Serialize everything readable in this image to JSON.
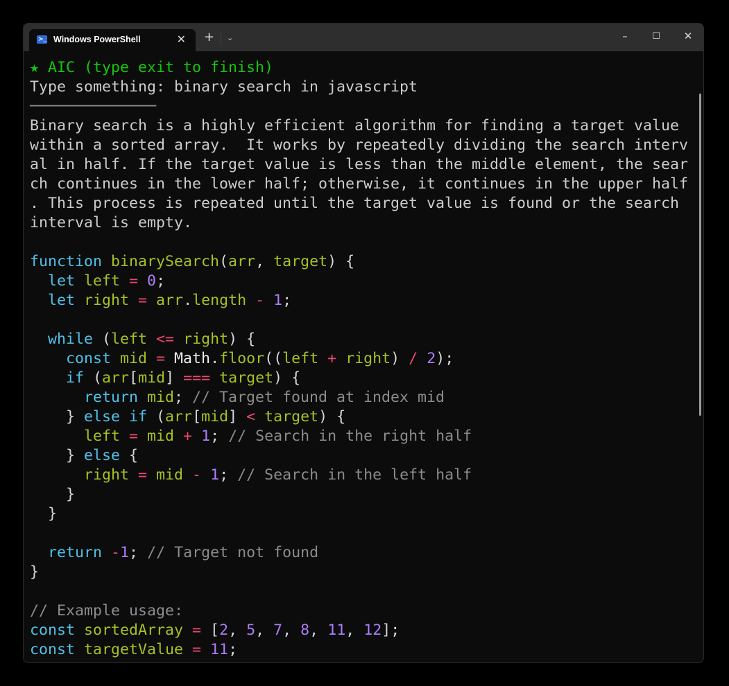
{
  "window": {
    "tab_title": "Windows PowerShell",
    "tab_icon": "powershell-icon",
    "close_tab": "✕",
    "new_tab": "+",
    "dropdown": "⌄",
    "minimize": "–",
    "maximize": "☐",
    "close": "✕"
  },
  "colors": {
    "background": "#0c0c0c",
    "titlebar": "#2e2e2e",
    "keyword": "#4fc1e9",
    "identifier": "#a8c023",
    "operator": "#f0476e",
    "number": "#ab7df8",
    "comment": "#8c8c8c",
    "prompt": "#16c60c"
  },
  "lines": [
    [
      [
        "g",
        "★ AIC (type exit to finish)"
      ]
    ],
    [
      [
        "t",
        "Type something: binary search in javascript"
      ]
    ],
    [
      [
        "c",
        "──────────────"
      ]
    ],
    [
      [
        "t",
        "Binary search is a highly efficient algorithm for finding a target value"
      ]
    ],
    [
      [
        "t",
        "within a sorted array.  It works by repeatedly dividing the search interv"
      ]
    ],
    [
      [
        "t",
        "al in half. If the target value is less than the middle element, the sear"
      ]
    ],
    [
      [
        "t",
        "ch continues in the lower half; otherwise, it continues in the upper half"
      ]
    ],
    [
      [
        "t",
        ". This process is repeated until the target value is found or the search"
      ]
    ],
    [
      [
        "t",
        "interval is empty."
      ]
    ],
    [],
    [
      [
        "k",
        "function "
      ],
      [
        "i",
        "binarySearch"
      ],
      [
        "p",
        "("
      ],
      [
        "i",
        "arr"
      ],
      [
        "p",
        ", "
      ],
      [
        "i",
        "target"
      ],
      [
        "p",
        ") {"
      ]
    ],
    [
      [
        "k",
        "  let "
      ],
      [
        "i",
        "left "
      ],
      [
        "o",
        "= "
      ],
      [
        "n",
        "0"
      ],
      [
        "p",
        ";"
      ]
    ],
    [
      [
        "k",
        "  let "
      ],
      [
        "i",
        "right "
      ],
      [
        "o",
        "= "
      ],
      [
        "i",
        "arr"
      ],
      [
        "p",
        "."
      ],
      [
        "i",
        "length "
      ],
      [
        "o",
        "- "
      ],
      [
        "n",
        "1"
      ],
      [
        "p",
        ";"
      ]
    ],
    [],
    [
      [
        "k",
        "  while "
      ],
      [
        "p",
        "("
      ],
      [
        "i",
        "left "
      ],
      [
        "o",
        "<= "
      ],
      [
        "i",
        "right"
      ],
      [
        "p",
        ") {"
      ]
    ],
    [
      [
        "k",
        "    const "
      ],
      [
        "i",
        "mid "
      ],
      [
        "o",
        "= "
      ],
      [
        "w",
        "Math"
      ],
      [
        "p",
        "."
      ],
      [
        "i",
        "floor"
      ],
      [
        "p",
        "(("
      ],
      [
        "i",
        "left "
      ],
      [
        "o",
        "+ "
      ],
      [
        "i",
        "right"
      ],
      [
        "p",
        ") "
      ],
      [
        "o",
        "/ "
      ],
      [
        "n",
        "2"
      ],
      [
        "p",
        ");"
      ]
    ],
    [
      [
        "k",
        "    if "
      ],
      [
        "p",
        "("
      ],
      [
        "i",
        "arr"
      ],
      [
        "p",
        "["
      ],
      [
        "i",
        "mid"
      ],
      [
        "p",
        "] "
      ],
      [
        "o",
        "=== "
      ],
      [
        "i",
        "target"
      ],
      [
        "p",
        ") {"
      ]
    ],
    [
      [
        "k",
        "      return "
      ],
      [
        "i",
        "mid"
      ],
      [
        "p",
        "; "
      ],
      [
        "c",
        "// Target found at index mid"
      ]
    ],
    [
      [
        "p",
        "    } "
      ],
      [
        "k",
        "else if "
      ],
      [
        "p",
        "("
      ],
      [
        "i",
        "arr"
      ],
      [
        "p",
        "["
      ],
      [
        "i",
        "mid"
      ],
      [
        "p",
        "] "
      ],
      [
        "o",
        "< "
      ],
      [
        "i",
        "target"
      ],
      [
        "p",
        ") {"
      ]
    ],
    [
      [
        "i",
        "      left "
      ],
      [
        "o",
        "= "
      ],
      [
        "i",
        "mid "
      ],
      [
        "o",
        "+ "
      ],
      [
        "n",
        "1"
      ],
      [
        "p",
        "; "
      ],
      [
        "c",
        "// Search in the right half"
      ]
    ],
    [
      [
        "p",
        "    } "
      ],
      [
        "k",
        "else "
      ],
      [
        "p",
        "{"
      ]
    ],
    [
      [
        "i",
        "      right "
      ],
      [
        "o",
        "= "
      ],
      [
        "i",
        "mid "
      ],
      [
        "o",
        "- "
      ],
      [
        "n",
        "1"
      ],
      [
        "p",
        "; "
      ],
      [
        "c",
        "// Search in the left half"
      ]
    ],
    [
      [
        "p",
        "    }"
      ]
    ],
    [
      [
        "p",
        "  }"
      ]
    ],
    [],
    [
      [
        "k",
        "  return "
      ],
      [
        "o",
        "-"
      ],
      [
        "n",
        "1"
      ],
      [
        "p",
        "; "
      ],
      [
        "c",
        "// Target not found"
      ]
    ],
    [
      [
        "p",
        "}"
      ]
    ],
    [],
    [
      [
        "c",
        "// Example usage:"
      ]
    ],
    [
      [
        "k",
        "const "
      ],
      [
        "i",
        "sortedArray "
      ],
      [
        "o",
        "= "
      ],
      [
        "p",
        "["
      ],
      [
        "n",
        "2"
      ],
      [
        "p",
        ", "
      ],
      [
        "n",
        "5"
      ],
      [
        "p",
        ", "
      ],
      [
        "n",
        "7"
      ],
      [
        "p",
        ", "
      ],
      [
        "n",
        "8"
      ],
      [
        "p",
        ", "
      ],
      [
        "n",
        "11"
      ],
      [
        "p",
        ", "
      ],
      [
        "n",
        "12"
      ],
      [
        "p",
        "];"
      ]
    ],
    [
      [
        "k",
        "const "
      ],
      [
        "i",
        "targetValue "
      ],
      [
        "o",
        "= "
      ],
      [
        "n",
        "11"
      ],
      [
        "p",
        ";"
      ]
    ]
  ]
}
